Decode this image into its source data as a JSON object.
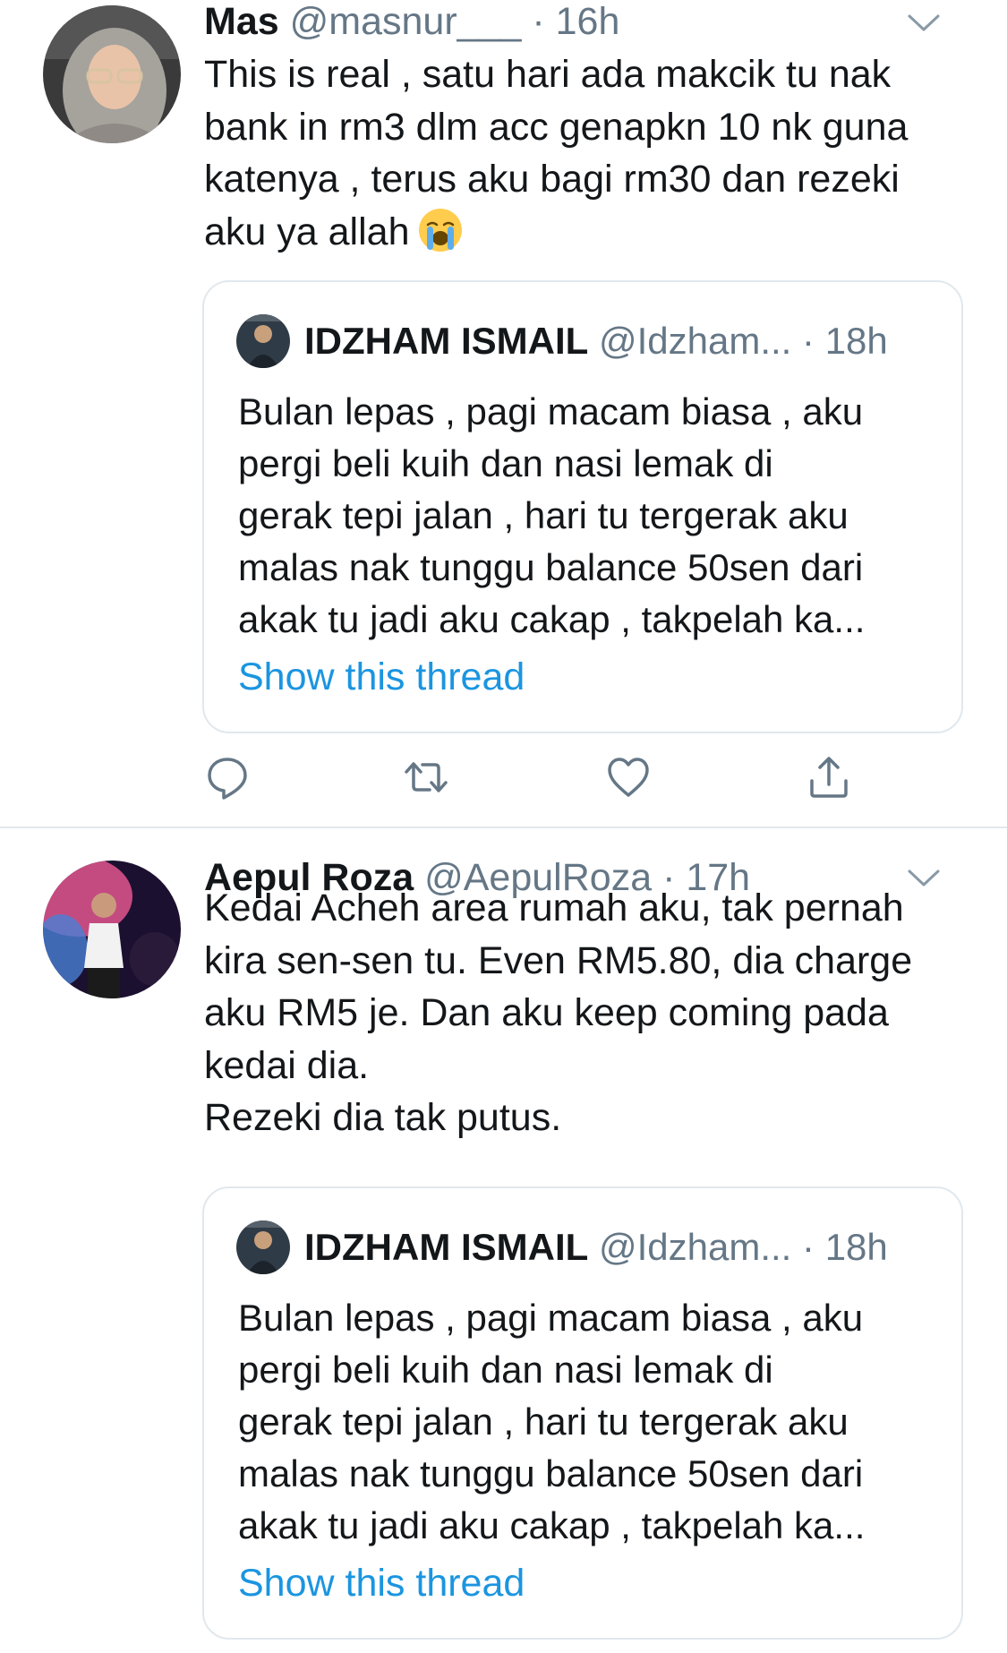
{
  "tweets": [
    {
      "name": "Mas",
      "handle": "@masnur___",
      "dot": "·",
      "time": "16h",
      "text_lines": [
        "This is real , satu hari ada makcik tu nak",
        "bank in rm3 dlm acc genapkn 10 nk guna",
        "katenya , terus aku bagi rm30 dan rezeki",
        "aku ya allah"
      ],
      "emoji": "loudly-crying-face",
      "quote": {
        "name": "IDZHAM ISMAIL",
        "handle": "@Idzham...",
        "dot": "·",
        "time": "18h",
        "text_lines": [
          "Bulan lepas , pagi macam biasa , aku",
          "pergi beli kuih dan nasi lemak di",
          "gerak tepi jalan , hari tu tergerak aku",
          "malas nak tunggu balance 50sen dari",
          "akak tu jadi aku cakap , takpelah ka..."
        ],
        "link": "Show this thread"
      },
      "actions": [
        "reply-icon",
        "retweet-icon",
        "like-icon",
        "share-icon"
      ]
    },
    {
      "name": "Aepul Roza",
      "handle": "@AepulRoza",
      "dot": "·",
      "time": "17h",
      "text_lines": [
        "Kedai Acheh area rumah aku, tak pernah",
        "kira sen-sen tu. Even RM5.80, dia charge",
        "aku RM5 je. Dan aku keep coming pada",
        "kedai dia.",
        "Rezeki dia tak putus."
      ],
      "quote": {
        "name": "IDZHAM ISMAIL",
        "handle": "@Idzham...",
        "dot": "·",
        "time": "18h",
        "text_lines": [
          "Bulan lepas , pagi macam biasa , aku",
          "pergi beli kuih dan nasi lemak di",
          "gerak tepi jalan , hari tu tergerak aku",
          "malas nak tunggu balance 50sen dari",
          "akak tu jadi aku cakap , takpelah ka..."
        ],
        "link": "Show this thread"
      }
    }
  ],
  "colors": {
    "text": "#14171a",
    "secondary": "#657786",
    "link": "#1b95e0",
    "border": "#e1e8ed"
  }
}
